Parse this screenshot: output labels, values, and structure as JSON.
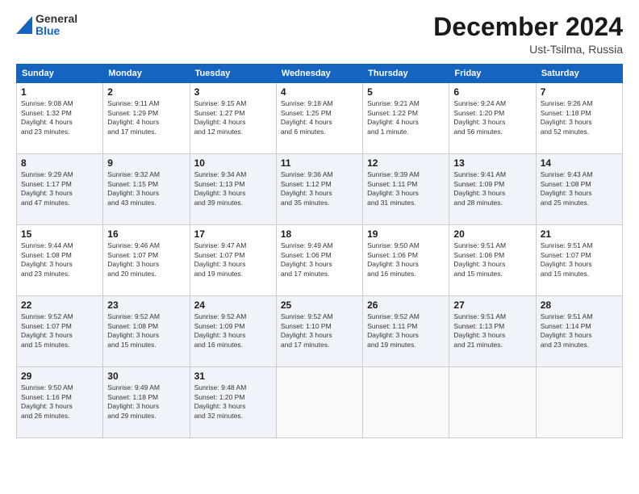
{
  "header": {
    "logo_general": "General",
    "logo_blue": "Blue",
    "month_title": "December 2024",
    "location": "Ust-Tsilma, Russia"
  },
  "weekdays": [
    "Sunday",
    "Monday",
    "Tuesday",
    "Wednesday",
    "Thursday",
    "Friday",
    "Saturday"
  ],
  "weeks": [
    [
      {
        "day": "1",
        "sunrise": "Sunrise: 9:08 AM",
        "sunset": "Sunset: 1:32 PM",
        "daylight": "Daylight: 4 hours",
        "daylight2": "and 23 minutes."
      },
      {
        "day": "2",
        "sunrise": "Sunrise: 9:11 AM",
        "sunset": "Sunset: 1:29 PM",
        "daylight": "Daylight: 4 hours",
        "daylight2": "and 17 minutes."
      },
      {
        "day": "3",
        "sunrise": "Sunrise: 9:15 AM",
        "sunset": "Sunset: 1:27 PM",
        "daylight": "Daylight: 4 hours",
        "daylight2": "and 12 minutes."
      },
      {
        "day": "4",
        "sunrise": "Sunrise: 9:18 AM",
        "sunset": "Sunset: 1:25 PM",
        "daylight": "Daylight: 4 hours",
        "daylight2": "and 6 minutes."
      },
      {
        "day": "5",
        "sunrise": "Sunrise: 9:21 AM",
        "sunset": "Sunset: 1:22 PM",
        "daylight": "Daylight: 4 hours",
        "daylight2": "and 1 minute."
      },
      {
        "day": "6",
        "sunrise": "Sunrise: 9:24 AM",
        "sunset": "Sunset: 1:20 PM",
        "daylight": "Daylight: 3 hours",
        "daylight2": "and 56 minutes."
      },
      {
        "day": "7",
        "sunrise": "Sunrise: 9:26 AM",
        "sunset": "Sunset: 1:18 PM",
        "daylight": "Daylight: 3 hours",
        "daylight2": "and 52 minutes."
      }
    ],
    [
      {
        "day": "8",
        "sunrise": "Sunrise: 9:29 AM",
        "sunset": "Sunset: 1:17 PM",
        "daylight": "Daylight: 3 hours",
        "daylight2": "and 47 minutes."
      },
      {
        "day": "9",
        "sunrise": "Sunrise: 9:32 AM",
        "sunset": "Sunset: 1:15 PM",
        "daylight": "Daylight: 3 hours",
        "daylight2": "and 43 minutes."
      },
      {
        "day": "10",
        "sunrise": "Sunrise: 9:34 AM",
        "sunset": "Sunset: 1:13 PM",
        "daylight": "Daylight: 3 hours",
        "daylight2": "and 39 minutes."
      },
      {
        "day": "11",
        "sunrise": "Sunrise: 9:36 AM",
        "sunset": "Sunset: 1:12 PM",
        "daylight": "Daylight: 3 hours",
        "daylight2": "and 35 minutes."
      },
      {
        "day": "12",
        "sunrise": "Sunrise: 9:39 AM",
        "sunset": "Sunset: 1:11 PM",
        "daylight": "Daylight: 3 hours",
        "daylight2": "and 31 minutes."
      },
      {
        "day": "13",
        "sunrise": "Sunrise: 9:41 AM",
        "sunset": "Sunset: 1:09 PM",
        "daylight": "Daylight: 3 hours",
        "daylight2": "and 28 minutes."
      },
      {
        "day": "14",
        "sunrise": "Sunrise: 9:43 AM",
        "sunset": "Sunset: 1:08 PM",
        "daylight": "Daylight: 3 hours",
        "daylight2": "and 25 minutes."
      }
    ],
    [
      {
        "day": "15",
        "sunrise": "Sunrise: 9:44 AM",
        "sunset": "Sunset: 1:08 PM",
        "daylight": "Daylight: 3 hours",
        "daylight2": "and 23 minutes."
      },
      {
        "day": "16",
        "sunrise": "Sunrise: 9:46 AM",
        "sunset": "Sunset: 1:07 PM",
        "daylight": "Daylight: 3 hours",
        "daylight2": "and 20 minutes."
      },
      {
        "day": "17",
        "sunrise": "Sunrise: 9:47 AM",
        "sunset": "Sunset: 1:07 PM",
        "daylight": "Daylight: 3 hours",
        "daylight2": "and 19 minutes."
      },
      {
        "day": "18",
        "sunrise": "Sunrise: 9:49 AM",
        "sunset": "Sunset: 1:06 PM",
        "daylight": "Daylight: 3 hours",
        "daylight2": "and 17 minutes."
      },
      {
        "day": "19",
        "sunrise": "Sunrise: 9:50 AM",
        "sunset": "Sunset: 1:06 PM",
        "daylight": "Daylight: 3 hours",
        "daylight2": "and 16 minutes."
      },
      {
        "day": "20",
        "sunrise": "Sunrise: 9:51 AM",
        "sunset": "Sunset: 1:06 PM",
        "daylight": "Daylight: 3 hours",
        "daylight2": "and 15 minutes."
      },
      {
        "day": "21",
        "sunrise": "Sunrise: 9:51 AM",
        "sunset": "Sunset: 1:07 PM",
        "daylight": "Daylight: 3 hours",
        "daylight2": "and 15 minutes."
      }
    ],
    [
      {
        "day": "22",
        "sunrise": "Sunrise: 9:52 AM",
        "sunset": "Sunset: 1:07 PM",
        "daylight": "Daylight: 3 hours",
        "daylight2": "and 15 minutes."
      },
      {
        "day": "23",
        "sunrise": "Sunrise: 9:52 AM",
        "sunset": "Sunset: 1:08 PM",
        "daylight": "Daylight: 3 hours",
        "daylight2": "and 15 minutes."
      },
      {
        "day": "24",
        "sunrise": "Sunrise: 9:52 AM",
        "sunset": "Sunset: 1:09 PM",
        "daylight": "Daylight: 3 hours",
        "daylight2": "and 16 minutes."
      },
      {
        "day": "25",
        "sunrise": "Sunrise: 9:52 AM",
        "sunset": "Sunset: 1:10 PM",
        "daylight": "Daylight: 3 hours",
        "daylight2": "and 17 minutes."
      },
      {
        "day": "26",
        "sunrise": "Sunrise: 9:52 AM",
        "sunset": "Sunset: 1:11 PM",
        "daylight": "Daylight: 3 hours",
        "daylight2": "and 19 minutes."
      },
      {
        "day": "27",
        "sunrise": "Sunrise: 9:51 AM",
        "sunset": "Sunset: 1:13 PM",
        "daylight": "Daylight: 3 hours",
        "daylight2": "and 21 minutes."
      },
      {
        "day": "28",
        "sunrise": "Sunrise: 9:51 AM",
        "sunset": "Sunset: 1:14 PM",
        "daylight": "Daylight: 3 hours",
        "daylight2": "and 23 minutes."
      }
    ],
    [
      {
        "day": "29",
        "sunrise": "Sunrise: 9:50 AM",
        "sunset": "Sunset: 1:16 PM",
        "daylight": "Daylight: 3 hours",
        "daylight2": "and 26 minutes."
      },
      {
        "day": "30",
        "sunrise": "Sunrise: 9:49 AM",
        "sunset": "Sunset: 1:18 PM",
        "daylight": "Daylight: 3 hours",
        "daylight2": "and 29 minutes."
      },
      {
        "day": "31",
        "sunrise": "Sunrise: 9:48 AM",
        "sunset": "Sunset: 1:20 PM",
        "daylight": "Daylight: 3 hours",
        "daylight2": "and 32 minutes."
      },
      null,
      null,
      null,
      null
    ]
  ]
}
